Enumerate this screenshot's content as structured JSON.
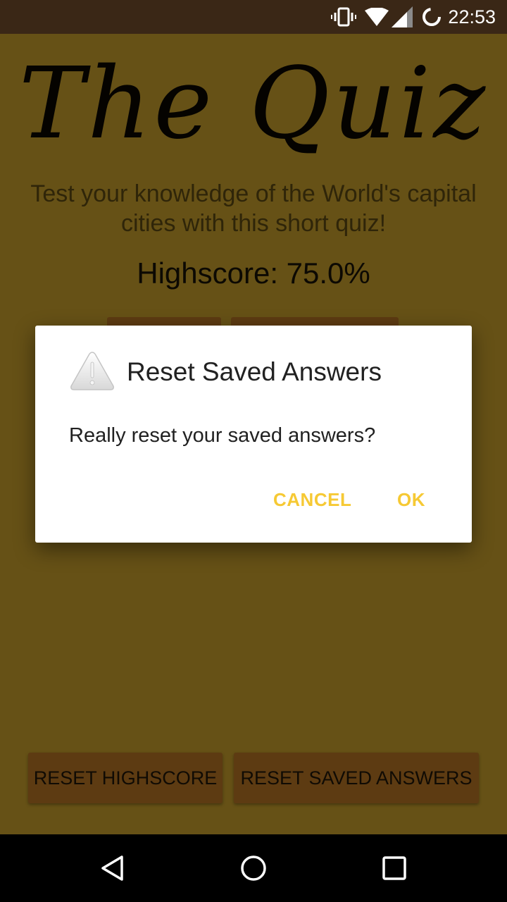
{
  "status_bar": {
    "time": "22:53",
    "icons": [
      "vibrate-icon",
      "wifi-icon",
      "cell-signal-icon",
      "battery-charging-icon"
    ]
  },
  "app": {
    "title": "The Quiz",
    "tagline": "Test your knowledge of the World's capital cities with this short quiz!",
    "highscore": "Highscore: 75.0%",
    "buttons": {
      "reset_highscore": "RESET HIGHSCORE",
      "reset_saved_answers": "RESET SAVED ANSWERS"
    }
  },
  "dialog": {
    "icon": "warning-icon",
    "title": "Reset Saved Answers",
    "message": "Really reset your saved answers?",
    "cancel_label": "CANCEL",
    "ok_label": "OK"
  },
  "nav_bar": {
    "buttons": [
      "back-icon",
      "home-icon",
      "recents-icon"
    ]
  },
  "colors": {
    "status_bar": "#3a2716",
    "background_dimmed": "#665116",
    "button_dimmed": "#5d3b12",
    "dialog_accent": "#f6c934"
  }
}
